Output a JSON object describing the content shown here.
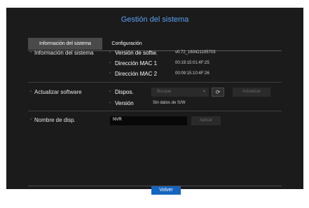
{
  "title": "Gestión del sistema",
  "tabs": [
    {
      "label": "Información del sistema",
      "active": true
    },
    {
      "label": "Configuración",
      "active": false
    }
  ],
  "system_info": {
    "section_label": "Información del sistema",
    "rows": [
      {
        "label": "Versión de softw.",
        "value": "v0.72_160421195703"
      },
      {
        "label": "Dirección MAC 1",
        "value": "00:19:15:01:4F:25"
      },
      {
        "label": "Dirección MAC 2",
        "value": "00:09:15:10:4F:26"
      }
    ]
  },
  "update": {
    "section_label": "Actualizar software",
    "device_label": "Dispos.",
    "device_select": "Busque",
    "update_button": "Actualizar",
    "version_label": "Versión",
    "version_value": "Sin datos de S/W"
  },
  "device_name": {
    "section_label": "Nombre de disp.",
    "value": "NVR",
    "apply_button": "Aplicar"
  },
  "footer": {
    "back_button": "Volver"
  },
  "colors": {
    "title": "#5a9ff0",
    "back_button": "#1565c0",
    "panel_bg": "#1b1b1b"
  },
  "icons": {
    "refresh": "refresh-icon",
    "dropdown": "chevron-down-icon"
  }
}
